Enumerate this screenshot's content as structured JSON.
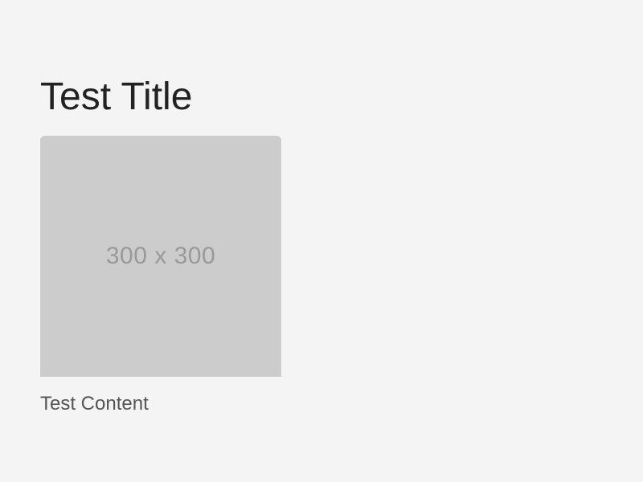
{
  "page": {
    "title": "Test Title",
    "content": "Test Content"
  },
  "image": {
    "placeholder_label": "300 x 300"
  },
  "colors": {
    "background": "#f4f4f4",
    "title_text": "#222222",
    "placeholder_fill": "#cccccc",
    "placeholder_text": "#999999",
    "content_text": "#555555"
  }
}
